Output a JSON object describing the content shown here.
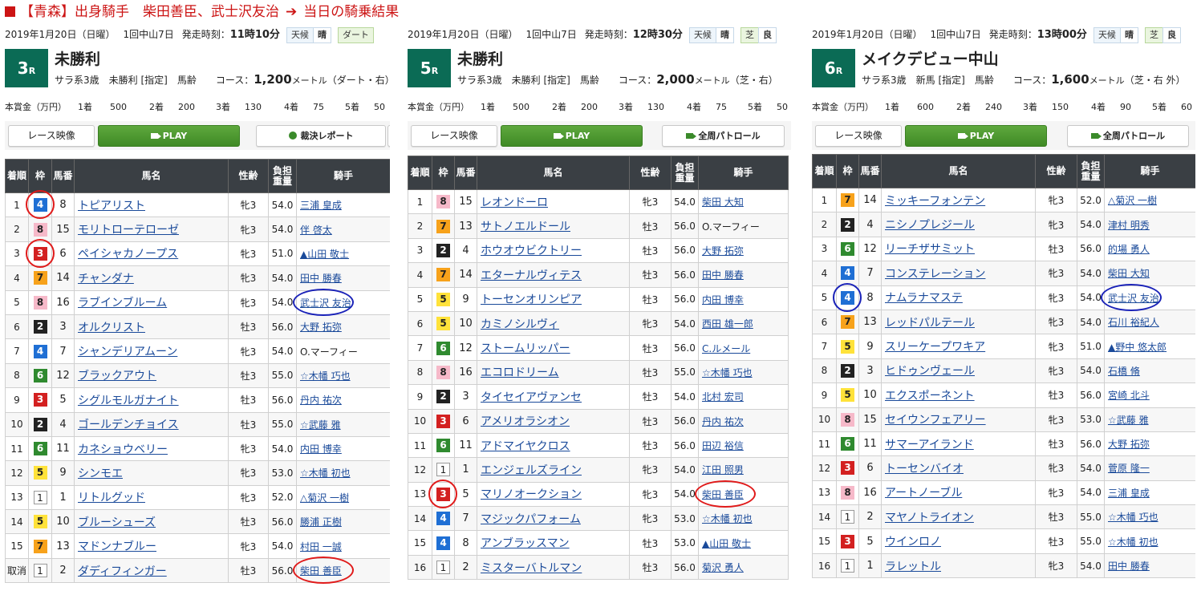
{
  "title": {
    "prefix": "【青森】出身騎手",
    "names": "柴田善臣、武士沢友治",
    "arrow": "➔",
    "suffix": "当日の騎乗結果"
  },
  "colors": {
    "title_red": "#cc1414",
    "race_box_green": "#0b6b55",
    "play_green": "#3f8a25",
    "header_dark": "#3a3f44",
    "link_blue": "#1a4a9a",
    "circle_red": "#e01a1a",
    "circle_blue": "#1a22b8"
  },
  "labels": {
    "weather": "天候",
    "th_rank": "着順",
    "th_waku": "枠",
    "th_uma": "馬番",
    "th_horse": "馬名",
    "th_sexage": "性齢",
    "th_weight": "負担重量",
    "th_jockey": "騎手",
    "prize_head": "本賞金（万円）",
    "play": "PLAY",
    "race_video": "レース映像"
  },
  "panels": [
    {
      "date": "2019年1月20日（日曜）",
      "meet": "1回中山7日",
      "start_label": "発走時刻：",
      "start_time": "11時10分",
      "weather_val": "晴",
      "surface": "ダート",
      "race_no": "3",
      "race_suffix": "R",
      "race_name": "未勝利",
      "conditions": "サラ系3歳　未勝利 [指定]　馬齢",
      "course_label": "コース：",
      "distance": "1,200",
      "unit": "メートル",
      "course_detail": "（ダート・右）",
      "prizes": [
        "1着",
        "500",
        "2着",
        "200",
        "3着",
        "130",
        "4着",
        "75",
        "5着",
        "50"
      ],
      "third_button": "裁決レポート",
      "third_button_icon": "report-icon",
      "rows": [
        {
          "rank": "1",
          "waku": "4",
          "uma": "8",
          "horse": "トピアリスト",
          "sex": "牝3",
          "wt": "54.0",
          "jockey": "三浦 皇成",
          "link": true
        },
        {
          "rank": "2",
          "waku": "8",
          "uma": "15",
          "horse": "モリトローテローゼ",
          "sex": "牝3",
          "wt": "54.0",
          "jockey": "伴 啓太",
          "link": true
        },
        {
          "rank": "3",
          "waku": "3",
          "uma": "6",
          "horse": "ペイシャカノープス",
          "sex": "牝3",
          "wt": "51.0",
          "jockey": "▲山田 敬士",
          "link": true
        },
        {
          "rank": "4",
          "waku": "7",
          "uma": "14",
          "horse": "チャンダナ",
          "sex": "牝3",
          "wt": "54.0",
          "jockey": "田中 勝春",
          "link": true
        },
        {
          "rank": "5",
          "waku": "8",
          "uma": "16",
          "horse": "ラブインブルーム",
          "sex": "牝3",
          "wt": "54.0",
          "jockey": "武士沢 友治",
          "link": true
        },
        {
          "rank": "6",
          "waku": "2",
          "uma": "3",
          "horse": "オルクリスト",
          "sex": "牡3",
          "wt": "56.0",
          "jockey": "大野 拓弥",
          "link": true
        },
        {
          "rank": "7",
          "waku": "4",
          "uma": "7",
          "horse": "シャンデリアムーン",
          "sex": "牝3",
          "wt": "54.0",
          "jockey": "O.マーフィー",
          "link": false
        },
        {
          "rank": "8",
          "waku": "6",
          "uma": "12",
          "horse": "ブラックアウト",
          "sex": "牡3",
          "wt": "55.0",
          "jockey": "☆木幡 巧也",
          "link": true
        },
        {
          "rank": "9",
          "waku": "3",
          "uma": "5",
          "horse": "シグルモルガナイト",
          "sex": "牡3",
          "wt": "56.0",
          "jockey": "丹内 祐次",
          "link": true
        },
        {
          "rank": "10",
          "waku": "2",
          "uma": "4",
          "horse": "ゴールデンチョイス",
          "sex": "牡3",
          "wt": "55.0",
          "jockey": "☆武藤 雅",
          "link": true
        },
        {
          "rank": "11",
          "waku": "6",
          "uma": "11",
          "horse": "カネショウベリー",
          "sex": "牝3",
          "wt": "54.0",
          "jockey": "内田 博幸",
          "link": true
        },
        {
          "rank": "12",
          "waku": "5",
          "uma": "9",
          "horse": "シンモエ",
          "sex": "牝3",
          "wt": "53.0",
          "jockey": "☆木幡 初也",
          "link": true
        },
        {
          "rank": "13",
          "waku": "1",
          "uma": "1",
          "horse": "リトルグッド",
          "sex": "牝3",
          "wt": "52.0",
          "jockey": "△菊沢 一樹",
          "link": true
        },
        {
          "rank": "14",
          "waku": "5",
          "uma": "10",
          "horse": "ブルーシューズ",
          "sex": "牡3",
          "wt": "56.0",
          "jockey": "勝浦 正樹",
          "link": true
        },
        {
          "rank": "15",
          "waku": "7",
          "uma": "13",
          "horse": "マドンナブルー",
          "sex": "牝3",
          "wt": "54.0",
          "jockey": "村田 一誠",
          "link": true
        },
        {
          "rank": "取消",
          "waku": "1",
          "uma": "2",
          "horse": "ダディフィンガー",
          "sex": "牡3",
          "wt": "56.0",
          "jockey": "柴田 善臣",
          "link": true
        }
      ]
    },
    {
      "date": "2019年1月20日（日曜）",
      "meet": "1回中山7日",
      "start_label": "発走時刻：",
      "start_time": "12時30分",
      "weather_val": "晴",
      "surface": "芝",
      "surface_val": "良",
      "race_no": "5",
      "race_suffix": "R",
      "race_name": "未勝利",
      "conditions": "サラ系3歳　未勝利 [指定]　馬齢",
      "course_label": "コース：",
      "distance": "2,000",
      "unit": "メートル",
      "course_detail": "（芝・右）",
      "prizes": [
        "1着",
        "500",
        "2着",
        "200",
        "3着",
        "130",
        "4着",
        "75",
        "5着",
        "50"
      ],
      "third_button": "全周パトロール",
      "third_button_icon": "camera-icon",
      "rows": [
        {
          "rank": "1",
          "waku": "8",
          "uma": "15",
          "horse": "レオンドーロ",
          "sex": "牝3",
          "wt": "54.0",
          "jockey": "柴田 大知",
          "link": true
        },
        {
          "rank": "2",
          "waku": "7",
          "uma": "13",
          "horse": "サトノエルドール",
          "sex": "牡3",
          "wt": "56.0",
          "jockey": "O.マーフィー",
          "link": false
        },
        {
          "rank": "3",
          "waku": "2",
          "uma": "4",
          "horse": "ホウオウビクトリー",
          "sex": "牡3",
          "wt": "56.0",
          "jockey": "大野 拓弥",
          "link": true
        },
        {
          "rank": "4",
          "waku": "7",
          "uma": "14",
          "horse": "エターナルヴィテス",
          "sex": "牡3",
          "wt": "56.0",
          "jockey": "田中 勝春",
          "link": true
        },
        {
          "rank": "5",
          "waku": "5",
          "uma": "9",
          "horse": "トーセンオリンピア",
          "sex": "牡3",
          "wt": "56.0",
          "jockey": "内田 博幸",
          "link": true
        },
        {
          "rank": "6",
          "waku": "5",
          "uma": "10",
          "horse": "カミノシルヴィ",
          "sex": "牝3",
          "wt": "54.0",
          "jockey": "西田 雄一郎",
          "link": true
        },
        {
          "rank": "7",
          "waku": "6",
          "uma": "12",
          "horse": "ストームリッパー",
          "sex": "牡3",
          "wt": "56.0",
          "jockey": "C.ルメール",
          "link": true
        },
        {
          "rank": "8",
          "waku": "8",
          "uma": "16",
          "horse": "エコロドリーム",
          "sex": "牡3",
          "wt": "55.0",
          "jockey": "☆木幡 巧也",
          "link": true
        },
        {
          "rank": "9",
          "waku": "2",
          "uma": "3",
          "horse": "タイセイアヴァンセ",
          "sex": "牡3",
          "wt": "54.0",
          "jockey": "北村 宏司",
          "link": true
        },
        {
          "rank": "10",
          "waku": "3",
          "uma": "6",
          "horse": "アメリオラシオン",
          "sex": "牡3",
          "wt": "56.0",
          "jockey": "丹内 祐次",
          "link": true
        },
        {
          "rank": "11",
          "waku": "6",
          "uma": "11",
          "horse": "アドマイヤクロス",
          "sex": "牡3",
          "wt": "56.0",
          "jockey": "田辺 裕信",
          "link": true
        },
        {
          "rank": "12",
          "waku": "1",
          "uma": "1",
          "horse": "エンジェルズライン",
          "sex": "牝3",
          "wt": "54.0",
          "jockey": "江田 照男",
          "link": true
        },
        {
          "rank": "13",
          "waku": "3",
          "uma": "5",
          "horse": "マリノオークション",
          "sex": "牝3",
          "wt": "54.0",
          "jockey": "柴田 善臣",
          "link": true
        },
        {
          "rank": "14",
          "waku": "4",
          "uma": "7",
          "horse": "マジックパフォーム",
          "sex": "牝3",
          "wt": "53.0",
          "jockey": "☆木幡 初也",
          "link": true
        },
        {
          "rank": "15",
          "waku": "4",
          "uma": "8",
          "horse": "アンブラッスマン",
          "sex": "牡3",
          "wt": "53.0",
          "jockey": "▲山田 敬士",
          "link": true
        },
        {
          "rank": "16",
          "waku": "1",
          "uma": "2",
          "horse": "ミスターバトルマン",
          "sex": "牡3",
          "wt": "56.0",
          "jockey": "菊沢 勇人",
          "link": true
        }
      ]
    },
    {
      "date": "2019年1月20日（日曜）",
      "meet": "1回中山7日",
      "start_label": "発走時刻：",
      "start_time": "13時00分",
      "weather_val": "晴",
      "surface": "芝",
      "surface_val": "良",
      "race_no": "6",
      "race_suffix": "R",
      "race_name": "メイクデビュー中山",
      "conditions": "サラ系3歳　新馬 [指定]　馬齢",
      "course_label": "コース：",
      "distance": "1,600",
      "unit": "メートル",
      "course_detail": "（芝・右 外）",
      "prizes": [
        "1着",
        "600",
        "2着",
        "240",
        "3着",
        "150",
        "4着",
        "90",
        "5着",
        "60"
      ],
      "third_button": "全周パトロール",
      "third_button_icon": "camera-icon",
      "rows": [
        {
          "rank": "1",
          "waku": "7",
          "uma": "14",
          "horse": "ミッキーフォンテン",
          "sex": "牝3",
          "wt": "52.0",
          "jockey": "△菊沢 一樹",
          "link": true
        },
        {
          "rank": "2",
          "waku": "2",
          "uma": "4",
          "horse": "ニシノプレジール",
          "sex": "牝3",
          "wt": "54.0",
          "jockey": "津村 明秀",
          "link": true
        },
        {
          "rank": "3",
          "waku": "6",
          "uma": "12",
          "horse": "リーチザサミット",
          "sex": "牡3",
          "wt": "56.0",
          "jockey": "的場 勇人",
          "link": true
        },
        {
          "rank": "4",
          "waku": "4",
          "uma": "7",
          "horse": "コンステレーション",
          "sex": "牝3",
          "wt": "54.0",
          "jockey": "柴田 大知",
          "link": true
        },
        {
          "rank": "5",
          "waku": "4",
          "uma": "8",
          "horse": "ナムラナマステ",
          "sex": "牝3",
          "wt": "54.0",
          "jockey": "武士沢 友治",
          "link": true
        },
        {
          "rank": "6",
          "waku": "7",
          "uma": "13",
          "horse": "レッドパルテール",
          "sex": "牝3",
          "wt": "54.0",
          "jockey": "石川 裕紀人",
          "link": true
        },
        {
          "rank": "7",
          "waku": "5",
          "uma": "9",
          "horse": "スリーケープワキア",
          "sex": "牝3",
          "wt": "51.0",
          "jockey": "▲野中 悠太郎",
          "link": true
        },
        {
          "rank": "8",
          "waku": "2",
          "uma": "3",
          "horse": "ヒドゥンヴェール",
          "sex": "牝3",
          "wt": "54.0",
          "jockey": "石橋 脩",
          "link": true
        },
        {
          "rank": "9",
          "waku": "5",
          "uma": "10",
          "horse": "エクスポーネント",
          "sex": "牡3",
          "wt": "56.0",
          "jockey": "宮崎 北斗",
          "link": true
        },
        {
          "rank": "10",
          "waku": "8",
          "uma": "15",
          "horse": "セイウンフェアリー",
          "sex": "牝3",
          "wt": "53.0",
          "jockey": "☆武藤 雅",
          "link": true
        },
        {
          "rank": "11",
          "waku": "6",
          "uma": "11",
          "horse": "サマーアイランド",
          "sex": "牡3",
          "wt": "56.0",
          "jockey": "大野 拓弥",
          "link": true
        },
        {
          "rank": "12",
          "waku": "3",
          "uma": "6",
          "horse": "トーセンバイオ",
          "sex": "牝3",
          "wt": "54.0",
          "jockey": "菅原 隆一",
          "link": true
        },
        {
          "rank": "13",
          "waku": "8",
          "uma": "16",
          "horse": "アートノーブル",
          "sex": "牝3",
          "wt": "54.0",
          "jockey": "三浦 皇成",
          "link": true
        },
        {
          "rank": "14",
          "waku": "1",
          "uma": "2",
          "horse": "マヤノトライオン",
          "sex": "牡3",
          "wt": "55.0",
          "jockey": "☆木幡 巧也",
          "link": true
        },
        {
          "rank": "15",
          "waku": "3",
          "uma": "5",
          "horse": "ウインロノ",
          "sex": "牡3",
          "wt": "55.0",
          "jockey": "☆木幡 初也",
          "link": true
        },
        {
          "rank": "16",
          "waku": "1",
          "uma": "1",
          "horse": "ラレットル",
          "sex": "牝3",
          "wt": "54.0",
          "jockey": "田中 勝春",
          "link": true
        }
      ]
    }
  ]
}
